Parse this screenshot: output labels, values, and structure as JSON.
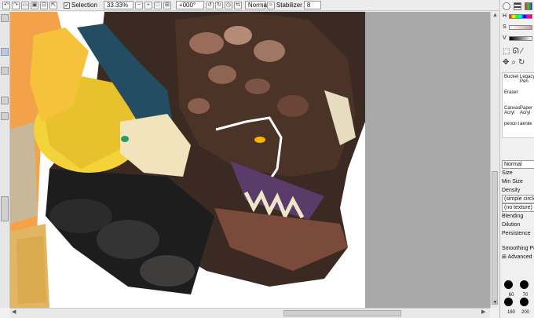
{
  "toolbar": {
    "selection_label": "Selection",
    "zoom_value": "33.33%",
    "rotation_value": "+000°",
    "blend_mode": "Normal",
    "stabilizer_label": "Stabilizer",
    "stabilizer_value": "8"
  },
  "color_panel": {
    "h_label": "H",
    "s_label": "S",
    "v_label": "V"
  },
  "tools": {
    "bucket": "Bucket",
    "legacy_pen": "Legacy Pen",
    "eraser": "Eraser",
    "canvas_acrylic": "Canvas Acryl",
    "paper_acrylic": "Paper Acryl",
    "pencil_brush": "pencil br",
    "akrilik": "akrilik"
  },
  "properties": {
    "mode": "Normal",
    "size_label": "Size",
    "min_size_label": "Min Size",
    "density_label": "Density",
    "shape_value": "(simple circle)",
    "texture_value": "(no texture)",
    "blending_label": "Blending",
    "dilution_label": "Dilution",
    "persistence_label": "Persistence",
    "smoothing_label": "Smoothing Pre",
    "advanced_label": "Advanced"
  },
  "brush_sizes": [
    "60",
    "70",
    "160",
    "200"
  ],
  "colors": {
    "canvas_gray": "#a9a9a9",
    "ui_bg": "#f0f0f0"
  }
}
